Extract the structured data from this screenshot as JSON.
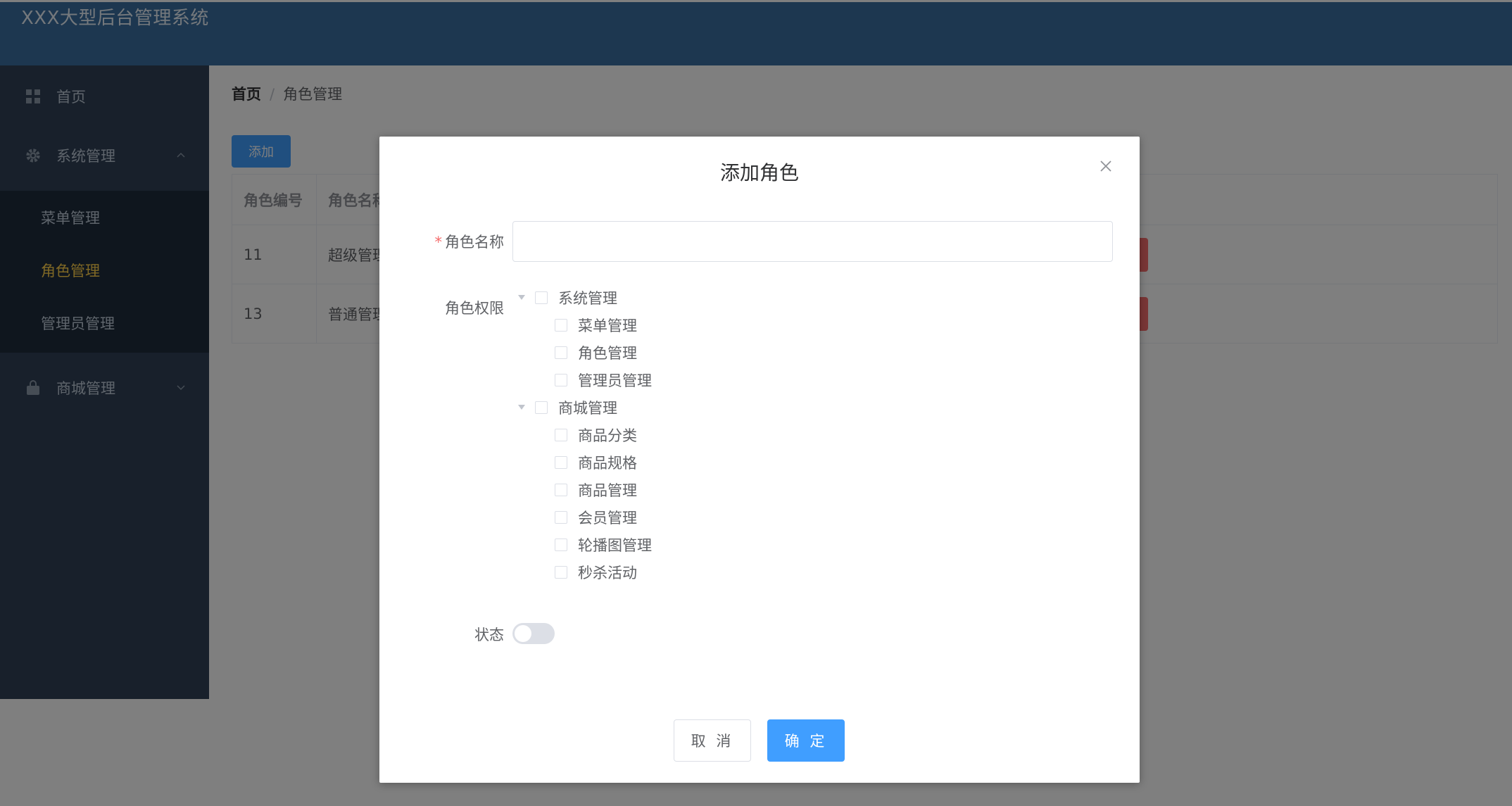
{
  "app": {
    "title": "XXX大型后台管理系统"
  },
  "sidebar": {
    "home": "首页",
    "system": "系统管理",
    "sub": [
      "菜单管理",
      "角色管理",
      "管理员管理"
    ],
    "mall": "商城管理",
    "active_color": "#ffd04b"
  },
  "breadcrumb": {
    "home": "首页",
    "current": "角色管理"
  },
  "toolbar": {
    "add_label": "添加"
  },
  "table": {
    "headers": [
      "角色编号",
      "角色名称"
    ],
    "rows": [
      {
        "id": "11",
        "name": "超级管理"
      },
      {
        "id": "13",
        "name": "普通管理"
      }
    ]
  },
  "dialog": {
    "title": "添加角色",
    "name_label": "角色名称",
    "name_value": "",
    "perm_label": "角色权限",
    "tree": [
      {
        "label": "系统管理",
        "children": [
          "菜单管理",
          "角色管理",
          "管理员管理"
        ]
      },
      {
        "label": "商城管理",
        "children": [
          "商品分类",
          "商品规格",
          "商品管理",
          "会员管理",
          "轮播图管理",
          "秒杀活动"
        ]
      }
    ],
    "status_label": "状态",
    "status_on": false,
    "cancel_label": "取 消",
    "confirm_label": "确 定"
  }
}
